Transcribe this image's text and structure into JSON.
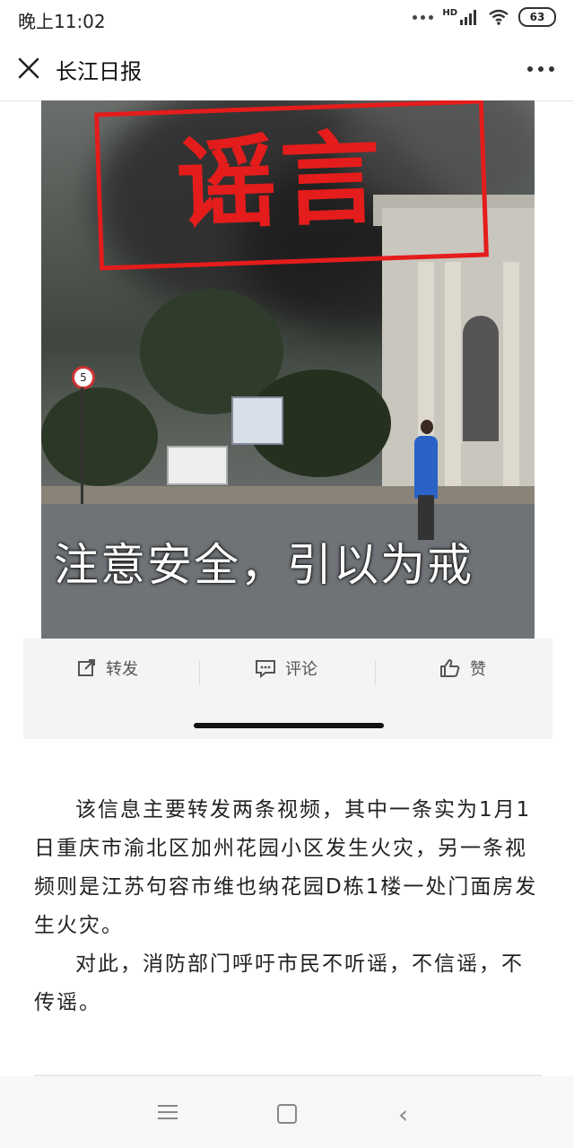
{
  "status_bar": {
    "time": "晚上11:02",
    "network": "HD",
    "battery": "63"
  },
  "nav": {
    "title": "长江日报"
  },
  "image": {
    "stamp_text": "谣言",
    "caption": "注意安全，引以为戒",
    "sign_number": "5"
  },
  "actions": {
    "share": "转发",
    "comment": "评论",
    "like": "赞"
  },
  "article": {
    "paragraphs": [
      "该信息主要转发两条视频，其中一条实为1月1日重庆市渝北区加州花园小区发生火灾，另一条视频则是江苏句容市维也纳花园D栋1楼一处门面房发生火灾。",
      "对此，消防部门呼吁市民不听谣，不信谣，不传谣。"
    ]
  },
  "icons": {
    "close": "close-icon",
    "more": "more-icon",
    "share": "share-icon",
    "comment": "comment-icon",
    "like": "like-icon"
  }
}
